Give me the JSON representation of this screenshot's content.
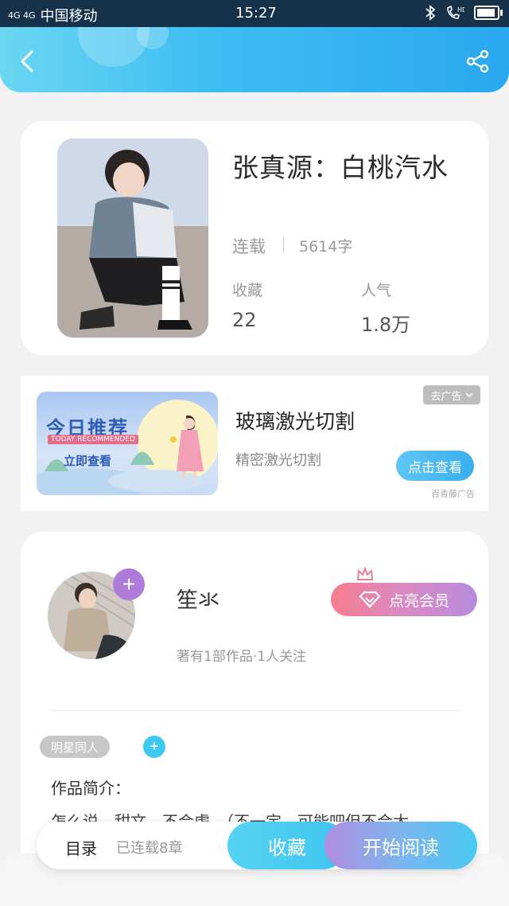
{
  "status_bar": {
    "signal": "4G 4G",
    "carrier": "中国移动",
    "time": "15:27",
    "icons": [
      "bluetooth-icon",
      "hd-call-icon",
      "battery-icon"
    ]
  },
  "header": {
    "back_icon": "chevron-left-icon",
    "share_icon": "share-icon",
    "color_start": "#6bd6f2",
    "color_end": "#2aa8f0"
  },
  "book": {
    "title": "张真源：白桃汽水",
    "status": "连载",
    "word_count": "5614字",
    "favorites_label": "收藏",
    "favorites_value": "22",
    "popularity_label": "人气",
    "popularity_value": "1.8万"
  },
  "ad": {
    "banner_title": "今日推荐",
    "banner_subtitle": "TODAY RECOMMENDED",
    "banner_cta": "立即查看",
    "close_label": "去广告",
    "title": "玻璃激光切割",
    "subtitle": "精密激光切割",
    "cta": "点击查看",
    "source": "百青藤广告"
  },
  "author": {
    "name": "笙氺",
    "meta": "著有1部作品·1人关注",
    "follow_icon": "plus-icon",
    "vip_label": "点亮会员",
    "tag": "明星同人",
    "intro_label": "作品简介：",
    "intro_text": "怎么说，甜文，不会虐，（不一定，可能吧但不会太"
  },
  "bottom_bar": {
    "toc_label": "目录",
    "toc_count": "已连载8章",
    "favorite_button": "收藏",
    "read_button": "开始阅读"
  }
}
